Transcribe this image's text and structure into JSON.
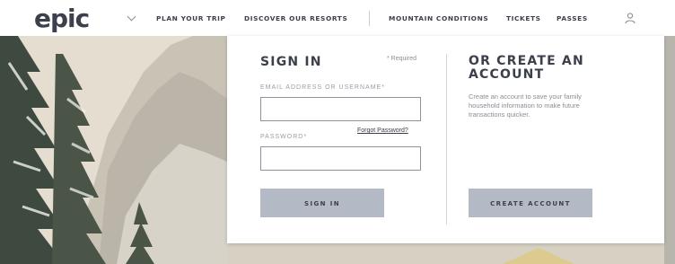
{
  "nav": {
    "logo": "epic",
    "links": [
      "PLAN YOUR TRIP",
      "DISCOVER OUR RESORTS",
      "MOUNTAIN CONDITIONS",
      "TICKETS",
      "PASSES"
    ]
  },
  "signin": {
    "heading": "SIGN IN",
    "required_note": "* Required",
    "email_label": "EMAIL ADDRESS OR USERNAME*",
    "email_value": "",
    "password_label": "PASSWORD*",
    "password_value": "",
    "forgot_link": "Forgot Password?",
    "submit_label": "SIGN IN"
  },
  "create": {
    "heading": "OR CREATE AN ACCOUNT",
    "description": "Create an account to save your family household information to make future transactions quicker.",
    "button_label": "CREATE ACCOUNT"
  },
  "colors": {
    "brand_dark": "#3c3f4c",
    "button_bg": "#b4bac5"
  },
  "icons": [
    "chevron-down-icon",
    "user-icon"
  ]
}
